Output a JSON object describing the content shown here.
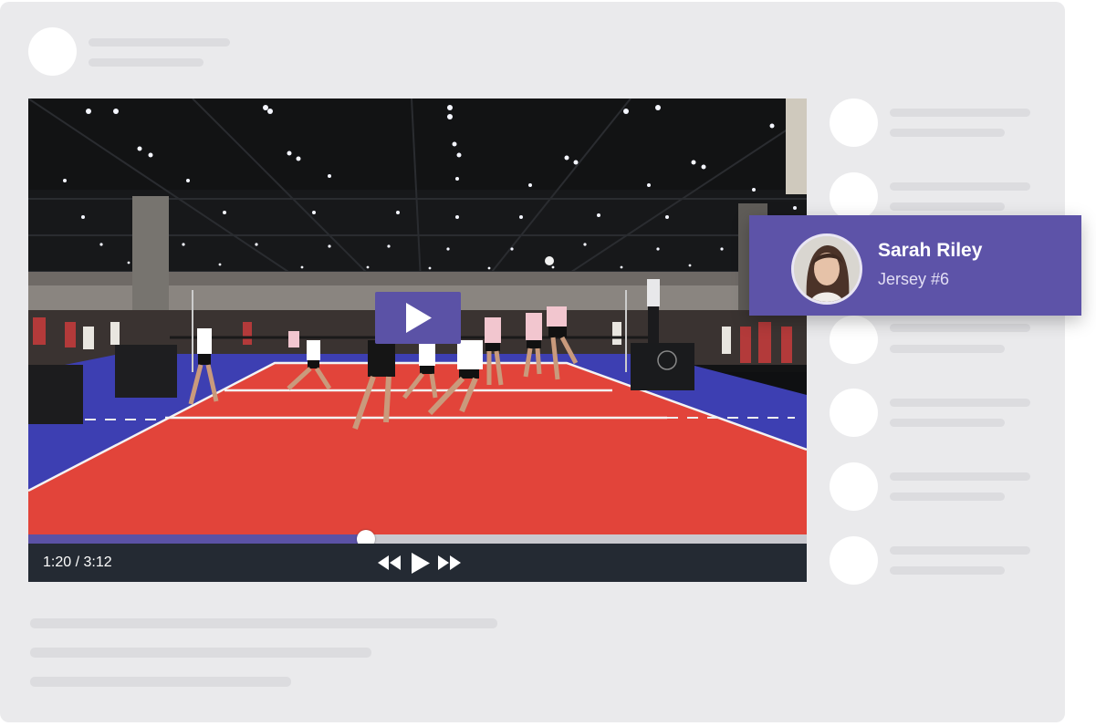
{
  "player_card": {
    "name": "Sarah Riley",
    "jersey": "Jersey #6"
  },
  "player": {
    "current_time": "1:20",
    "separator": " / ",
    "duration": "3:12",
    "time_display": "1:20 / 3:12",
    "progress_fraction": 0.434
  },
  "icons": {
    "big_play": "play-icon",
    "rewind": "rewind-icon",
    "play": "play-icon",
    "fast_forward": "fast-forward-icon"
  },
  "colors": {
    "accent": "#5b52a6",
    "control_bar": "#242a33",
    "court": "#e2443a",
    "court_border": "#3c3fb0"
  }
}
